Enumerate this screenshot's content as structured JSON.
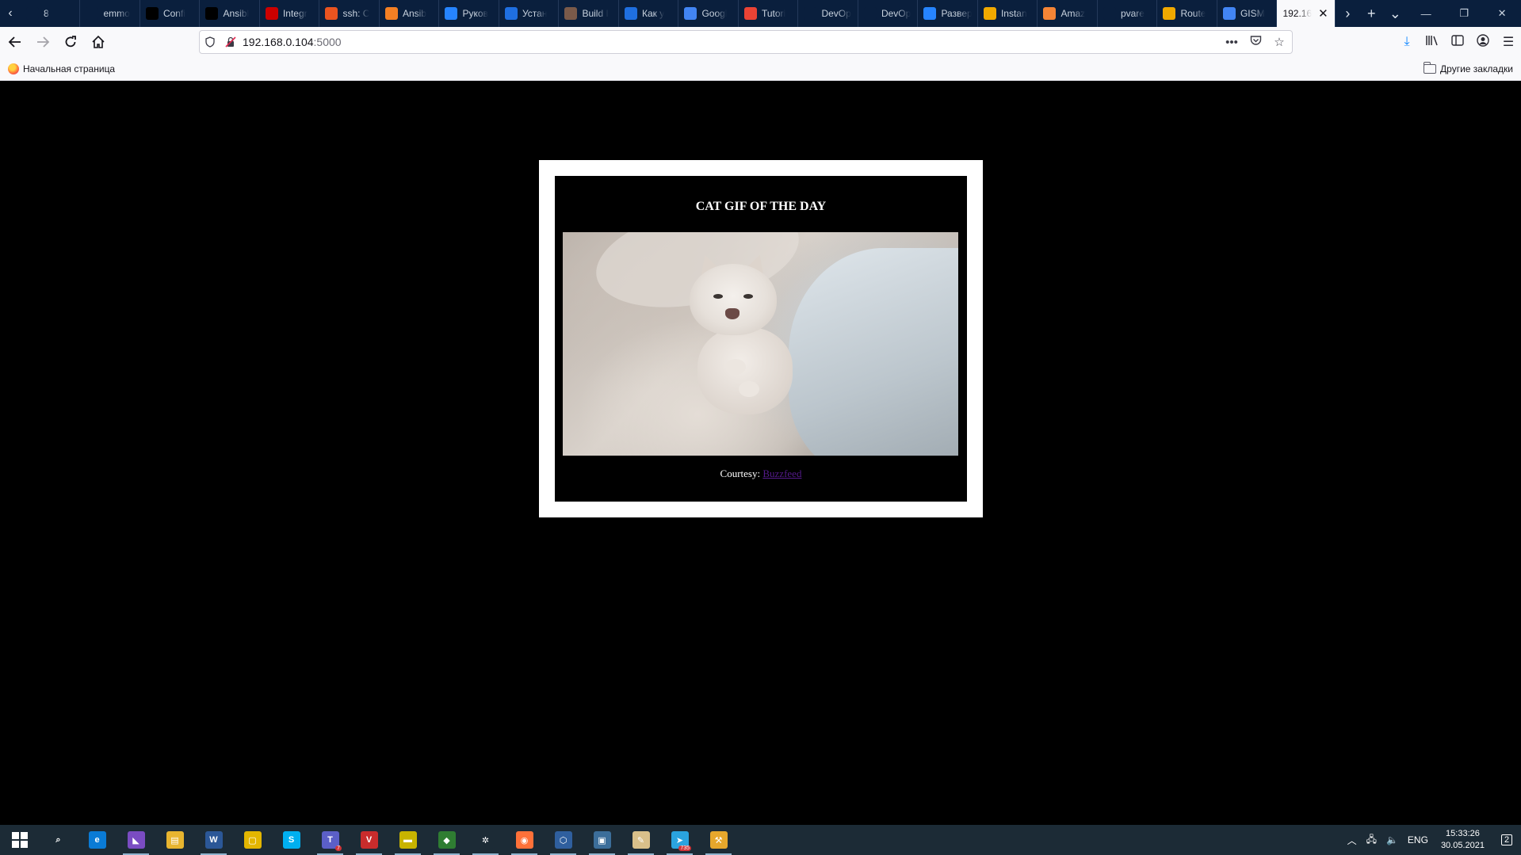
{
  "tabs": [
    {
      "label": "8",
      "icon": "blank-tab-icon",
      "color": "#0a1f3d"
    },
    {
      "label": "emmo",
      "icon": "blank-tab-icon",
      "color": "#0a1f3d"
    },
    {
      "label": "Confi",
      "icon": "medium-icon",
      "color": "#000000"
    },
    {
      "label": "Ansibl",
      "icon": "medium-icon",
      "color": "#000000"
    },
    {
      "label": "Integr",
      "icon": "redhat-icon",
      "color": "#cc0000"
    },
    {
      "label": "ssh: C",
      "icon": "askubuntu-icon",
      "color": "#e95420"
    },
    {
      "label": "Ansib",
      "icon": "stackoverflow-icon",
      "color": "#f48024"
    },
    {
      "label": "Руков",
      "icon": "confluence-icon",
      "color": "#2684ff"
    },
    {
      "label": "Устан",
      "icon": "loop-icon",
      "color": "#1f6fe0"
    },
    {
      "label": "Build I",
      "icon": "person-icon",
      "color": "#7a5a4a"
    },
    {
      "label": "Как у",
      "icon": "loop-icon",
      "color": "#1f6fe0"
    },
    {
      "label": "Googl",
      "icon": "google-translate-icon",
      "color": "#4285f4"
    },
    {
      "label": "Tutori",
      "icon": "gmail-icon",
      "color": "#ea4335"
    },
    {
      "label": "DevOp",
      "icon": "blank-tab-icon",
      "color": "#0a1f3d"
    },
    {
      "label": "DevOp",
      "icon": "blank-tab-icon",
      "color": "#0a1f3d"
    },
    {
      "label": "Развер",
      "icon": "confluence-icon",
      "color": "#2684ff"
    },
    {
      "label": "Instan",
      "icon": "aws-box-icon",
      "color": "#f0a900"
    },
    {
      "label": "Amaz",
      "icon": "aws-cube-icon",
      "color": "#f58536"
    },
    {
      "label": "pvare",
      "icon": "blank-tab-icon",
      "color": "#0a1f3d"
    },
    {
      "label": "Route",
      "icon": "aws-box-icon",
      "color": "#f0a900"
    },
    {
      "label": "GISM",
      "icon": "google-icon",
      "color": "#4285f4"
    }
  ],
  "active_tab": {
    "label": "192.16",
    "close_icon": "close-icon"
  },
  "window_controls": {
    "minimize": "—",
    "restore": "❐",
    "close": "✕"
  },
  "navbar": {
    "url_host": "192.168.0.104",
    "url_port": ":5000",
    "page_actions": "•••"
  },
  "bookmarks": {
    "home_label": "Начальная страница",
    "other_label": "Другие закладки"
  },
  "page": {
    "title": "CAT GIF OF THE DAY",
    "courtesy_prefix": "Courtesy: ",
    "courtesy_link": "Buzzfeed",
    "background_color": "#000000",
    "link_color": "#551a8b"
  },
  "taskbar": {
    "apps": [
      {
        "name": "search-icon",
        "glyph": "⌕",
        "color": "#1c2b36",
        "running": false
      },
      {
        "name": "edge-icon",
        "glyph": "e",
        "color": "#0a7bd6",
        "running": false
      },
      {
        "name": "visual-studio-icon",
        "glyph": "◣",
        "color": "#7a4cc2",
        "running": true
      },
      {
        "name": "file-explorer-icon",
        "glyph": "▤",
        "color": "#e8b52f",
        "running": false
      },
      {
        "name": "word-icon",
        "glyph": "W",
        "color": "#2b5797",
        "running": true
      },
      {
        "name": "sticky-app-icon",
        "glyph": "▢",
        "color": "#e3b600",
        "running": false
      },
      {
        "name": "skype-icon",
        "glyph": "S",
        "color": "#00aff0",
        "running": false
      },
      {
        "name": "teams-icon",
        "glyph": "T",
        "color": "#5b5fc7",
        "running": true,
        "badge": "7"
      },
      {
        "name": "vim-icon",
        "glyph": "V",
        "color": "#c92c2c",
        "running": true
      },
      {
        "name": "winscp-icon",
        "glyph": "▬",
        "color": "#c8b400",
        "running": true
      },
      {
        "name": "git-icon",
        "glyph": "◆",
        "color": "#2f7d32",
        "running": true
      },
      {
        "name": "settings-gear-icon",
        "glyph": "✲",
        "color": "#1c2b36",
        "running": true
      },
      {
        "name": "firefox-icon",
        "glyph": "◉",
        "color": "#ff7139",
        "running": true
      },
      {
        "name": "virtualbox-icon",
        "glyph": "⬡",
        "color": "#2f5f9e",
        "running": true
      },
      {
        "name": "remote-desktop-icon",
        "glyph": "▣",
        "color": "#3c6e9a",
        "running": true
      },
      {
        "name": "notepad-icon",
        "glyph": "✎",
        "color": "#d9c08a",
        "running": true
      },
      {
        "name": "telegram-icon",
        "glyph": "➤",
        "color": "#2aa3df",
        "running": true,
        "badge": "735"
      },
      {
        "name": "tool-icon",
        "glyph": "⚒",
        "color": "#e6a72c",
        "running": true
      }
    ],
    "tray": {
      "language": "ENG",
      "time": "15:33:26",
      "date": "30.05.2021",
      "notifications": "2"
    }
  }
}
